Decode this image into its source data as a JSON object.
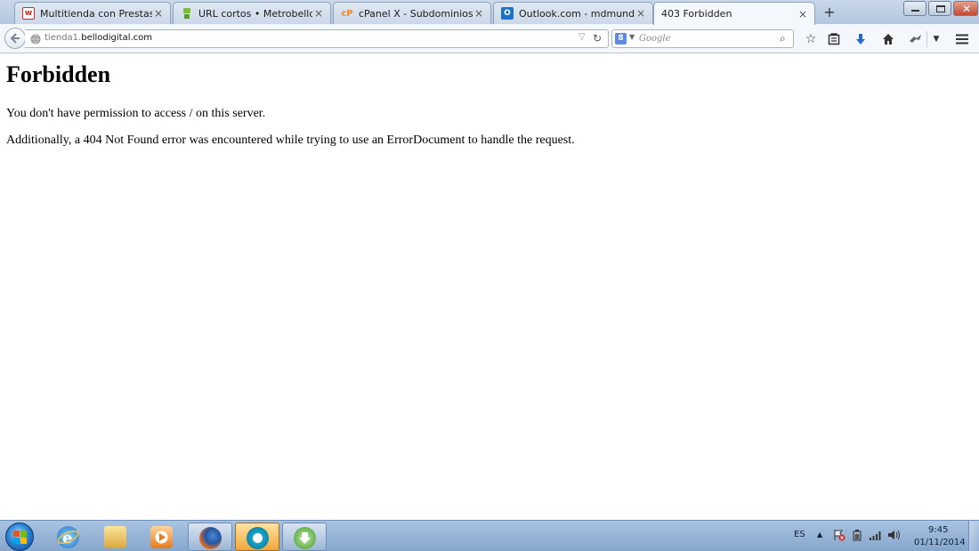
{
  "browser": {
    "tabs": [
      {
        "label": "Multitienda con Prestasho...",
        "favicon": "w-logo-icon",
        "favicon_color": "#d9261c",
        "active": false
      },
      {
        "label": "URL cortos • Metrobello",
        "favicon": "robot-icon",
        "favicon_color": "#7dbb3c",
        "active": false
      },
      {
        "label": "cPanel X - Subdominios",
        "favicon": "cpanel-icon",
        "favicon_color": "#f08a24",
        "active": false
      },
      {
        "label": "Outlook.com - mdmundo...",
        "favicon": "outlook-icon",
        "favicon_color": "#1a73c9",
        "active": false
      },
      {
        "label": "403 Forbidden",
        "favicon": "",
        "favicon_color": "",
        "active": true
      }
    ],
    "tab_close_glyph": "×",
    "new_tab_glyph": "+",
    "url": {
      "subdomain": "tienda1.",
      "domain": "bellodigital.com"
    },
    "search": {
      "engine_badge": "8",
      "placeholder": "Google"
    }
  },
  "page": {
    "heading": "Forbidden",
    "paragraph_1": "You don't have permission to access / on this server.",
    "paragraph_2": "Additionally, a 404 Not Found error was encountered while trying to use an ErrorDocument to handle the request."
  },
  "taskbar": {
    "language": "ES",
    "time": "9:45",
    "date": "01/11/2014",
    "apps": [
      {
        "name": "internet-explorer-icon",
        "state": "pinned"
      },
      {
        "name": "file-explorer-icon",
        "state": "pinned"
      },
      {
        "name": "media-player-icon",
        "state": "pinned"
      },
      {
        "name": "firefox-icon",
        "state": "running"
      },
      {
        "name": "opera-icon",
        "state": "active"
      },
      {
        "name": "download-manager-icon",
        "state": "running"
      }
    ]
  },
  "colors": {
    "accent_blue": "#2a6ad0",
    "titlebar": "#b4c7de",
    "taskbar": "#86a6cc"
  }
}
